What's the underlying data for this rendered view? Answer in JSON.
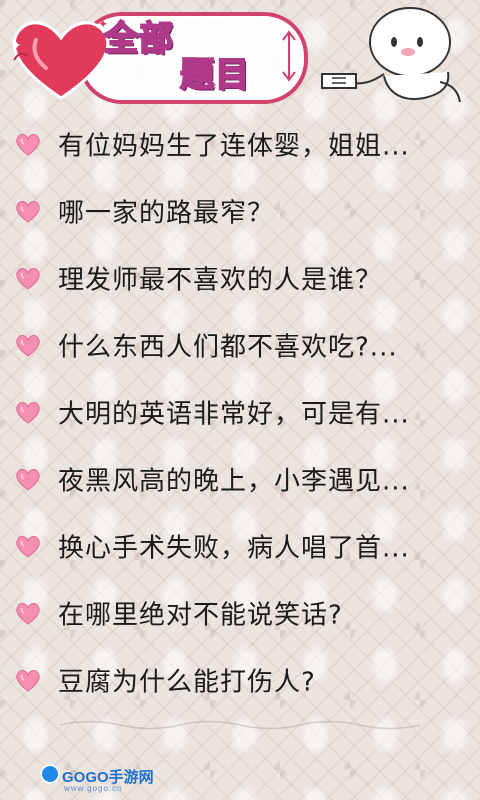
{
  "header": {
    "title_line1": "全部",
    "title_line2": "题目"
  },
  "questions": [
    {
      "text": "有位妈妈生了连体婴，姐姐..."
    },
    {
      "text": "哪一家的路最窄？"
    },
    {
      "text": "理发师最不喜欢的人是谁？"
    },
    {
      "text": "什么东西人们都不喜欢吃?..."
    },
    {
      "text": "大明的英语非常好，可是有..."
    },
    {
      "text": "夜黑风高的晚上，小李遇见..."
    },
    {
      "text": "换心手术失败，病人唱了首..."
    },
    {
      "text": "在哪里绝对不能说笑话?"
    },
    {
      "text": "豆腐为什么能打伤人?"
    }
  ],
  "watermark": {
    "label": "GOGO手游网",
    "sub": "www.gogo.cn"
  },
  "colors": {
    "accent": "#d0436c",
    "heart_icon": "#f48fb1",
    "text": "#1a1a1a"
  },
  "icons": {
    "list_bullet": "heart-icon",
    "logo": "heart-logo-icon",
    "mascot": "mascot-character-icon"
  }
}
